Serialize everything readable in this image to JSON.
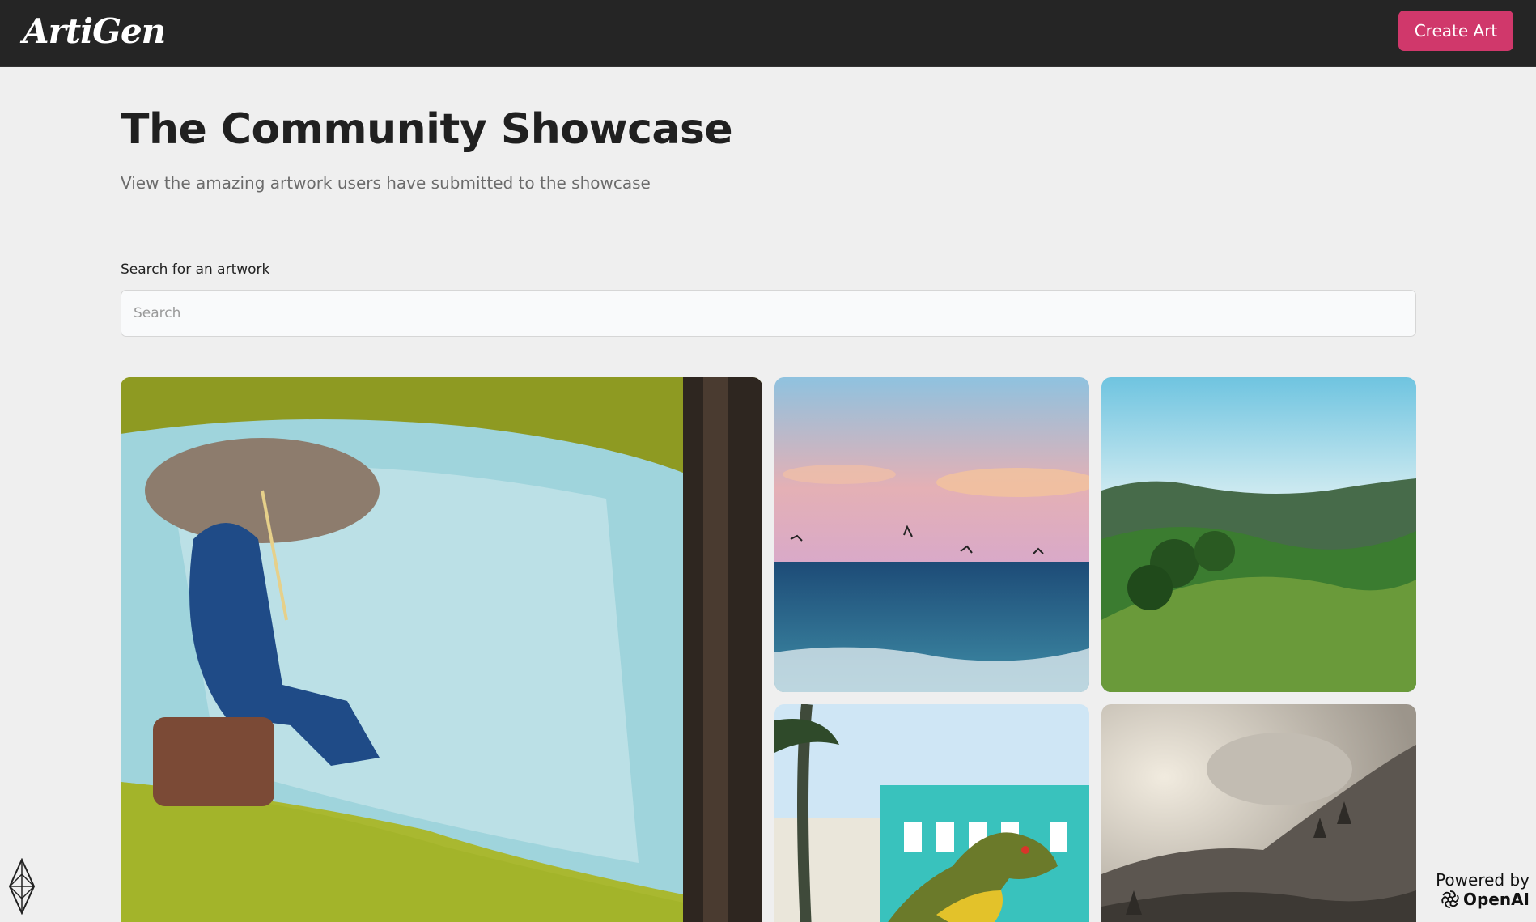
{
  "navbar": {
    "logo": "ArtiGen",
    "create_button": "Create Art"
  },
  "header": {
    "title": "The Community Showcase",
    "subtitle": "View the amazing artwork users have submitted to the showcase"
  },
  "search": {
    "label": "Search for an artwork",
    "placeholder": "Search",
    "value": ""
  },
  "gallery": {
    "items": [
      {
        "subject": "impressionist painting of man with umbrella by river"
      },
      {
        "subject": "ocean sunset with seagulls"
      },
      {
        "subject": "green rolling hills landscape"
      },
      {
        "subject": "toy dinosaur in front of turquoise building"
      },
      {
        "subject": "misty mountain landscape with trees"
      }
    ]
  },
  "footer": {
    "powered_by": "Powered by",
    "brand": "OpenAI"
  },
  "colors": {
    "navbar_bg": "#252525",
    "accent": "#d0386b",
    "page_bg": "#efefef"
  },
  "icons": {
    "corner": "diamond-logo-icon",
    "openai": "openai-logo-icon"
  }
}
